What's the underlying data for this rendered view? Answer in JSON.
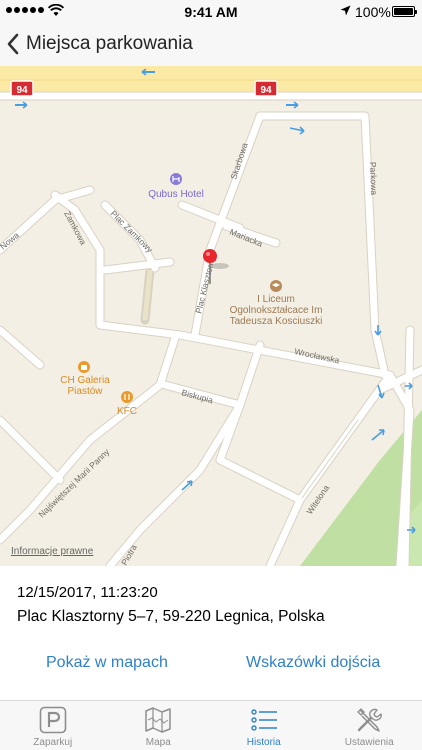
{
  "status_bar": {
    "time": "9:41 AM",
    "battery": "100%"
  },
  "nav": {
    "back_icon": "chevron-left-icon",
    "title": "Miejsca parkowania"
  },
  "map": {
    "road_shields": [
      "94",
      "94"
    ],
    "streets": [
      "Skarbowa",
      "Parkowa",
      "Mariacka",
      "Plac Zamkowy",
      "Zamkowa",
      "Nowa",
      "Plac Klasztorny",
      "Wrocławska",
      "Biskupia",
      "Najświętszej Marii Panny",
      "Witelona",
      "Piotra"
    ],
    "pois": [
      "Qubus Hotel",
      "I Liceum Ogolnokształcace Im Tadeusza Kosciuszki",
      "CH Galeria Piastów",
      "KFC"
    ],
    "legal_label": "Informacje prawne",
    "colors": {
      "land": "#f4efe4",
      "road": "#ffffff",
      "highway": "#fbe9a6",
      "park": "#bfe0a2",
      "poi": "#e99a2b",
      "pin": "#e8262c"
    }
  },
  "parking": {
    "datetime": "12/15/2017, 11:23:20",
    "address": "Plac Klasztorny 5–7, 59-220 Legnica, Polska",
    "show_in_maps": "Pokaż w mapach",
    "directions": "Wskazówki dojścia"
  },
  "tabs": [
    {
      "label": "Zaparkuj",
      "icon": "parking-icon",
      "active": false
    },
    {
      "label": "Mapa",
      "icon": "map-icon",
      "active": false
    },
    {
      "label": "Historia",
      "icon": "list-icon",
      "active": true
    },
    {
      "label": "Ustawienia",
      "icon": "tools-icon",
      "active": false
    }
  ]
}
